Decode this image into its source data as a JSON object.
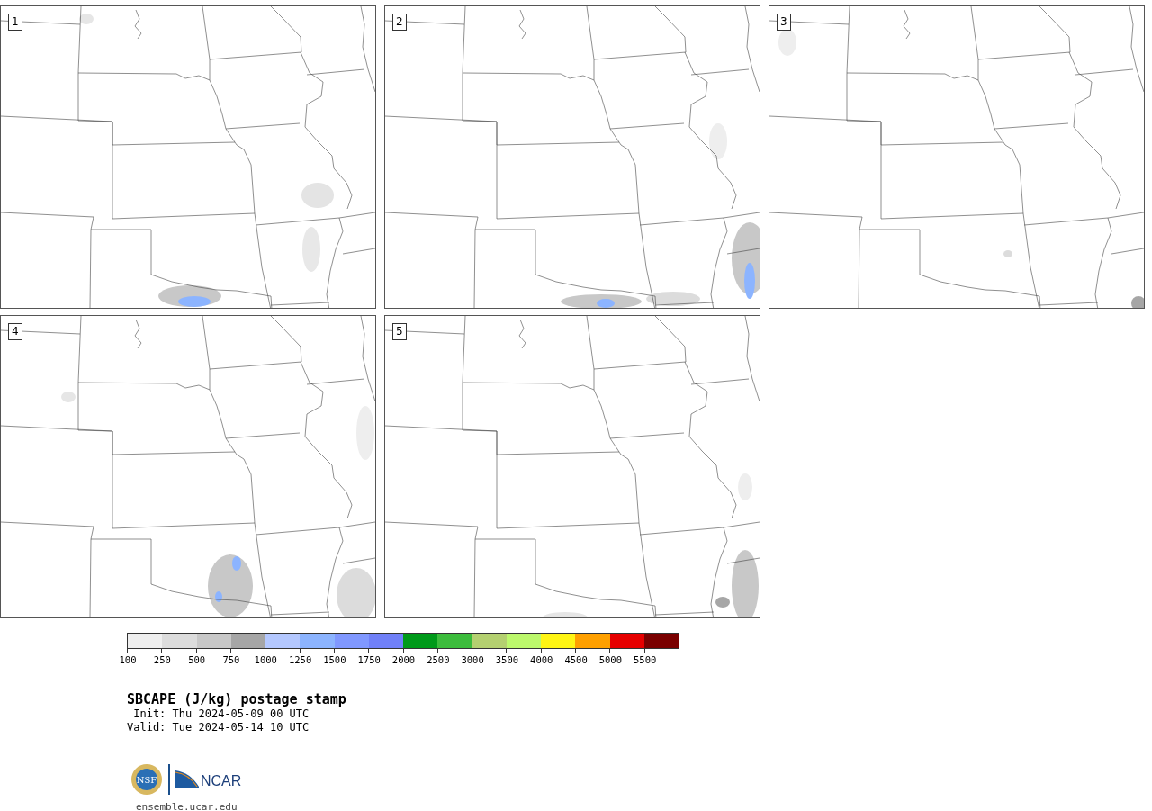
{
  "panels": [
    {
      "label": "1"
    },
    {
      "label": "2"
    },
    {
      "label": "3"
    },
    {
      "label": "4"
    },
    {
      "label": "5"
    }
  ],
  "colorbar": {
    "bins": [
      {
        "color": "#efefef",
        "label": "100"
      },
      {
        "color": "#dcdcdc",
        "label": "250"
      },
      {
        "color": "#c8c8c8",
        "label": "500"
      },
      {
        "color": "#a6a6a6",
        "label": "750"
      },
      {
        "color": "#b4c8ff",
        "label": "1000"
      },
      {
        "color": "#8cb4ff",
        "label": "1250"
      },
      {
        "color": "#8098ff",
        "label": "1500"
      },
      {
        "color": "#7080f8",
        "label": "1750"
      },
      {
        "color": "#009a1a",
        "label": "2000"
      },
      {
        "color": "#3cbc3c",
        "label": "2500"
      },
      {
        "color": "#b4d070",
        "label": "3000"
      },
      {
        "color": "#bcf86c",
        "label": "3500"
      },
      {
        "color": "#fff514",
        "label": "4000"
      },
      {
        "color": "#ffa000",
        "label": "4500"
      },
      {
        "color": "#e60000",
        "label": "5000"
      },
      {
        "color": "#7a0000",
        "label": "5500"
      }
    ]
  },
  "title": "SBCAPE (J/kg) postage stamp",
  "init": " Init: Thu 2024-05-09 00 UTC",
  "valid": "Valid: Tue 2024-05-14 10 UTC",
  "logos": {
    "nsf": "NSF",
    "ncar": "NCAR"
  },
  "footer_url": "ensemble.ucar.edu"
}
